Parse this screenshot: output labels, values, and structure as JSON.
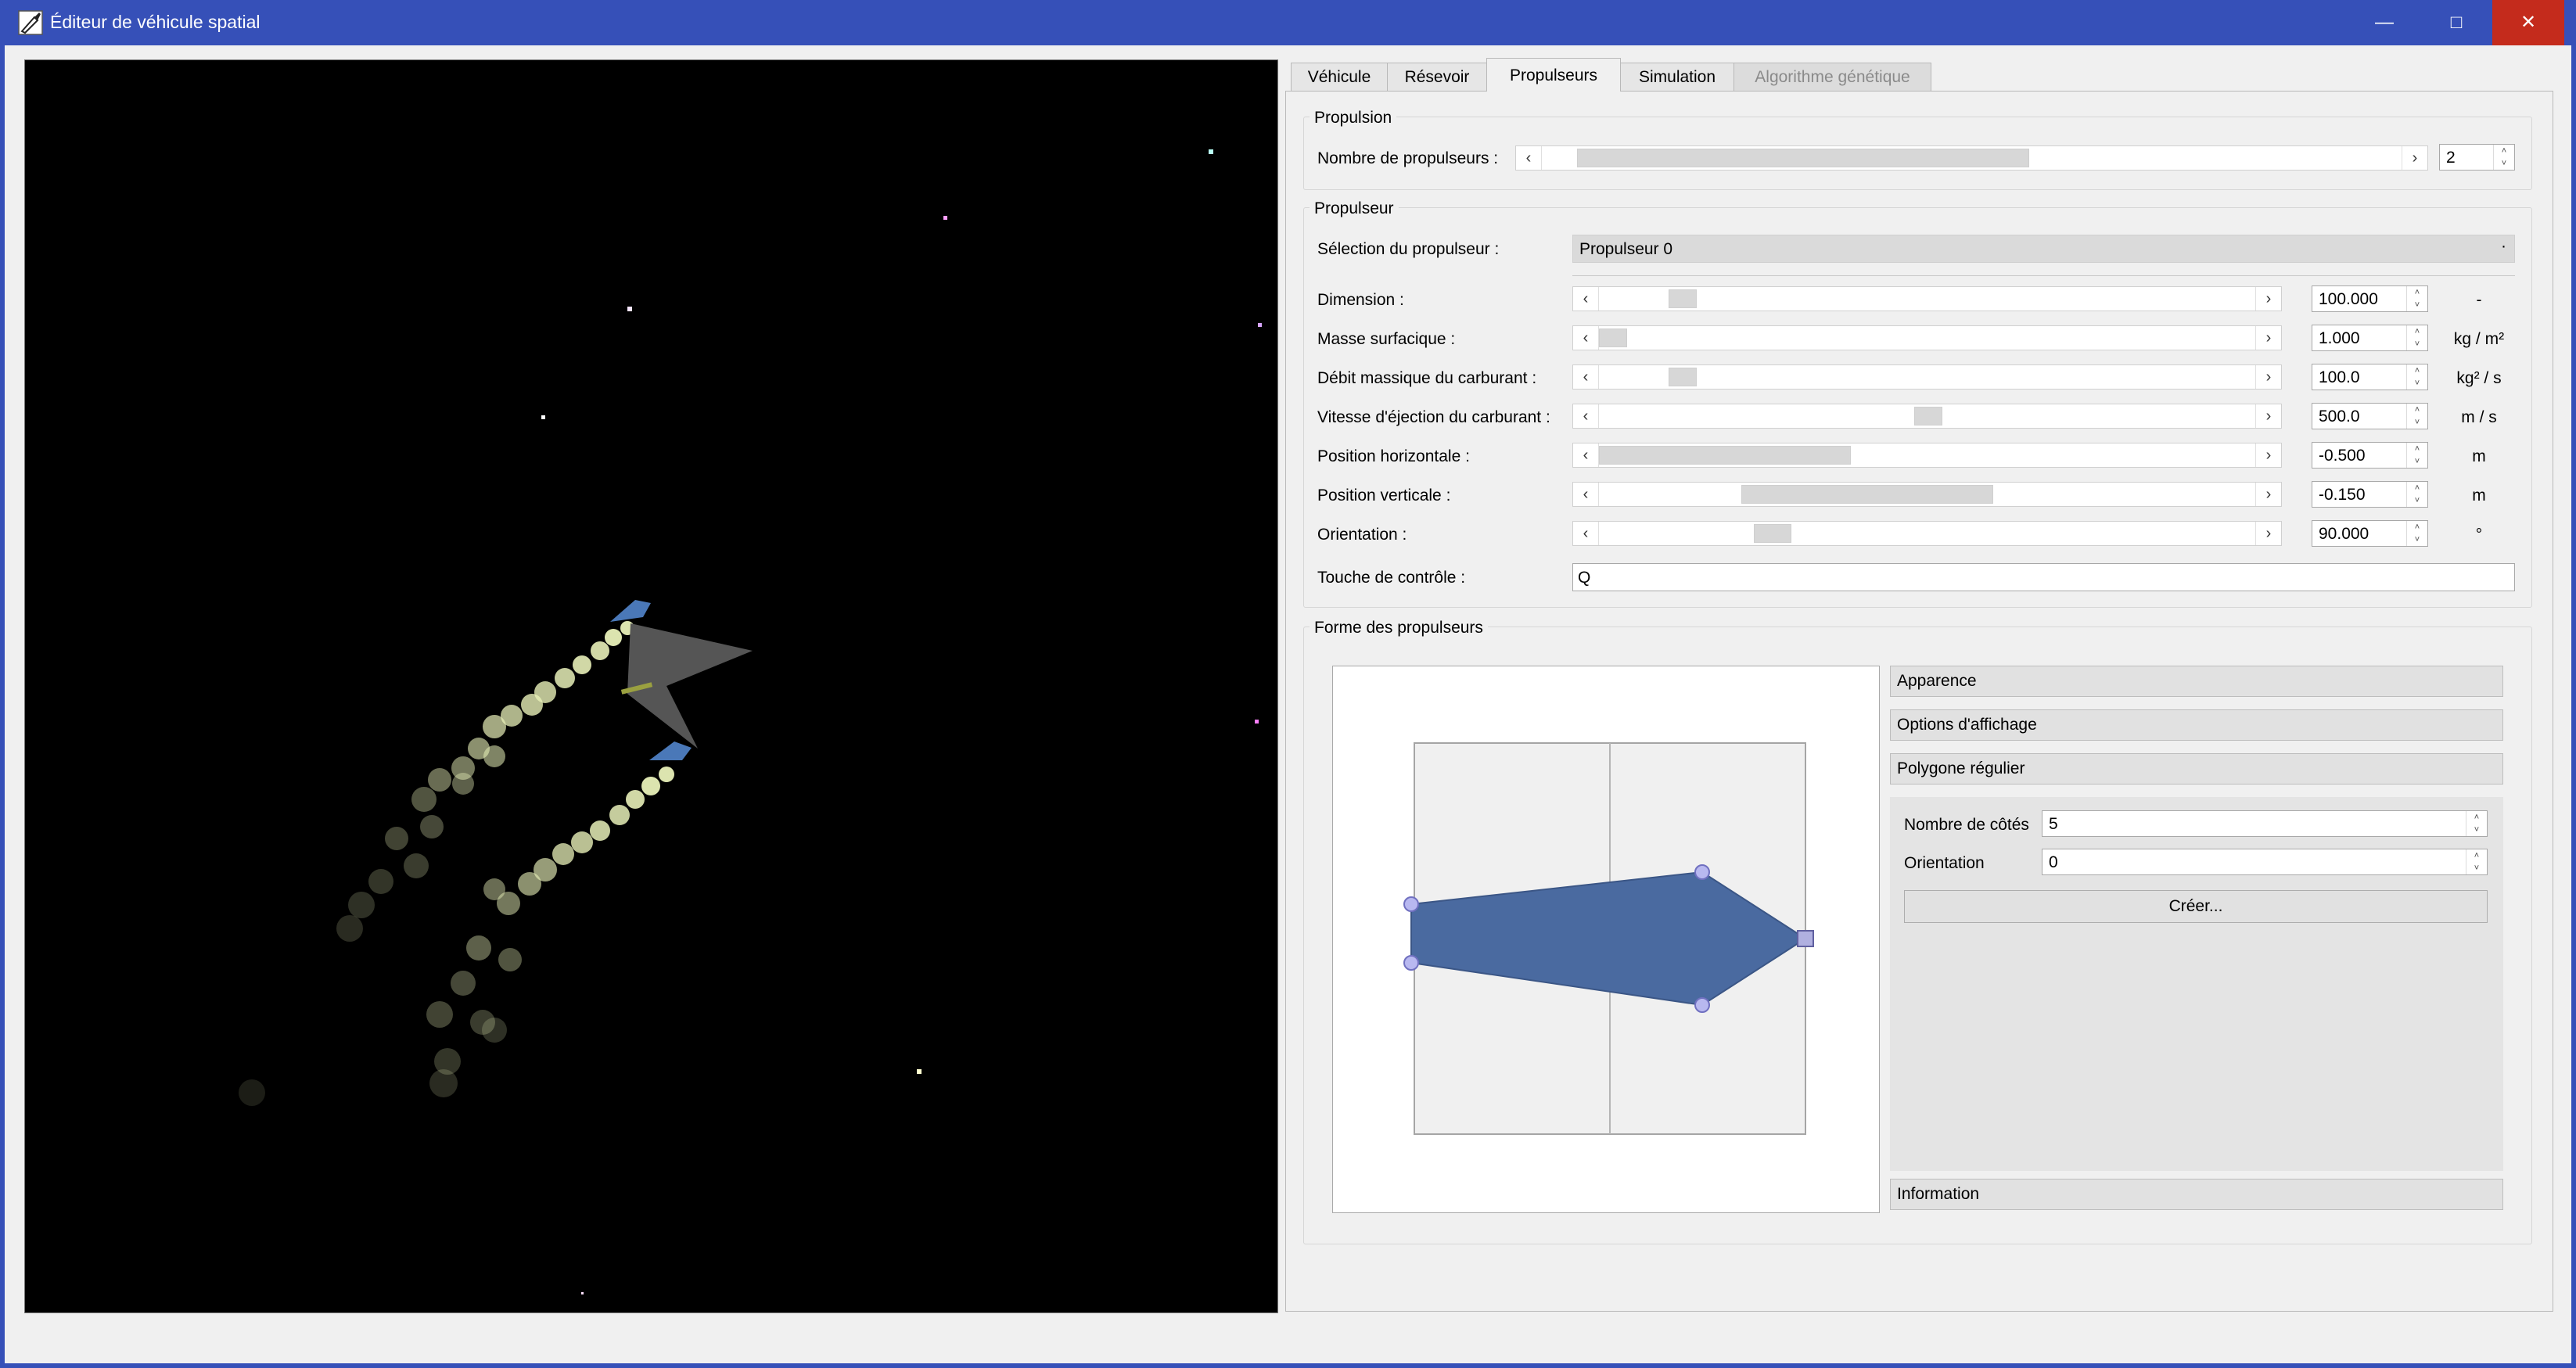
{
  "window": {
    "title": "Éditeur de véhicule spatial",
    "icon": "rocket-pen-icon",
    "controls": {
      "minimize": "—",
      "maximize": "□",
      "close": "✕"
    }
  },
  "tabs": [
    {
      "label": "Véhicule",
      "state": "normal"
    },
    {
      "label": "Résevoir",
      "state": "normal"
    },
    {
      "label": "Propulseurs",
      "state": "active"
    },
    {
      "label": "Simulation",
      "state": "normal"
    },
    {
      "label": "Algorithme génétique",
      "state": "disabled"
    }
  ],
  "propulsion": {
    "title": "Propulsion",
    "count_label": "Nombre de propulseurs :",
    "count_value": "2",
    "count_slider_fraction": 0.5
  },
  "propulseur": {
    "title": "Propulseur",
    "selection_label": "Sélection du propulseur :",
    "selection_value": "Propulseur 0",
    "rows": [
      {
        "label": "Dimension :",
        "value": "100.000",
        "unit": "-",
        "slider_fraction": 0.11
      },
      {
        "label": "Masse surfacique :",
        "value": "1.000",
        "unit": "kg / m²",
        "slider_fraction": 0.0
      },
      {
        "label": "Débit massique du carburant :",
        "value": "100.0",
        "unit": "kg² / s",
        "slider_fraction": 0.11
      },
      {
        "label": "Vitesse d'éjection du carburant :",
        "value": "500.0",
        "unit": "m / s",
        "slider_fraction": 0.5
      },
      {
        "label": "Position horizontale :",
        "value": "-0.500",
        "unit": "m",
        "slider_fraction": 0.0
      },
      {
        "label": "Position verticale :",
        "value": "-0.150",
        "unit": "m",
        "slider_fraction": 0.35
      },
      {
        "label": "Orientation :",
        "value": "90.000",
        "unit": "°",
        "slider_fraction": 0.25
      }
    ],
    "control_key_label": "Touche de contrôle :",
    "control_key_value": "Q"
  },
  "forme": {
    "title": "Forme des propulseurs",
    "toolbox": {
      "appearance": "Apparence",
      "display_options": "Options d'affichage",
      "regular_polygon": "Polygone régulier",
      "information": "Information"
    },
    "polygon": {
      "sides_label": "Nombre de côtés",
      "sides_value": "5",
      "orientation_label": "Orientation",
      "orientation_value": "0",
      "create_label": "Créer..."
    },
    "shape_color": "#4a6aa0"
  },
  "colors": {
    "titlebar": "#3650b8",
    "close": "#c42b1c",
    "space": "#000000",
    "thruster": "#4a78b8"
  }
}
